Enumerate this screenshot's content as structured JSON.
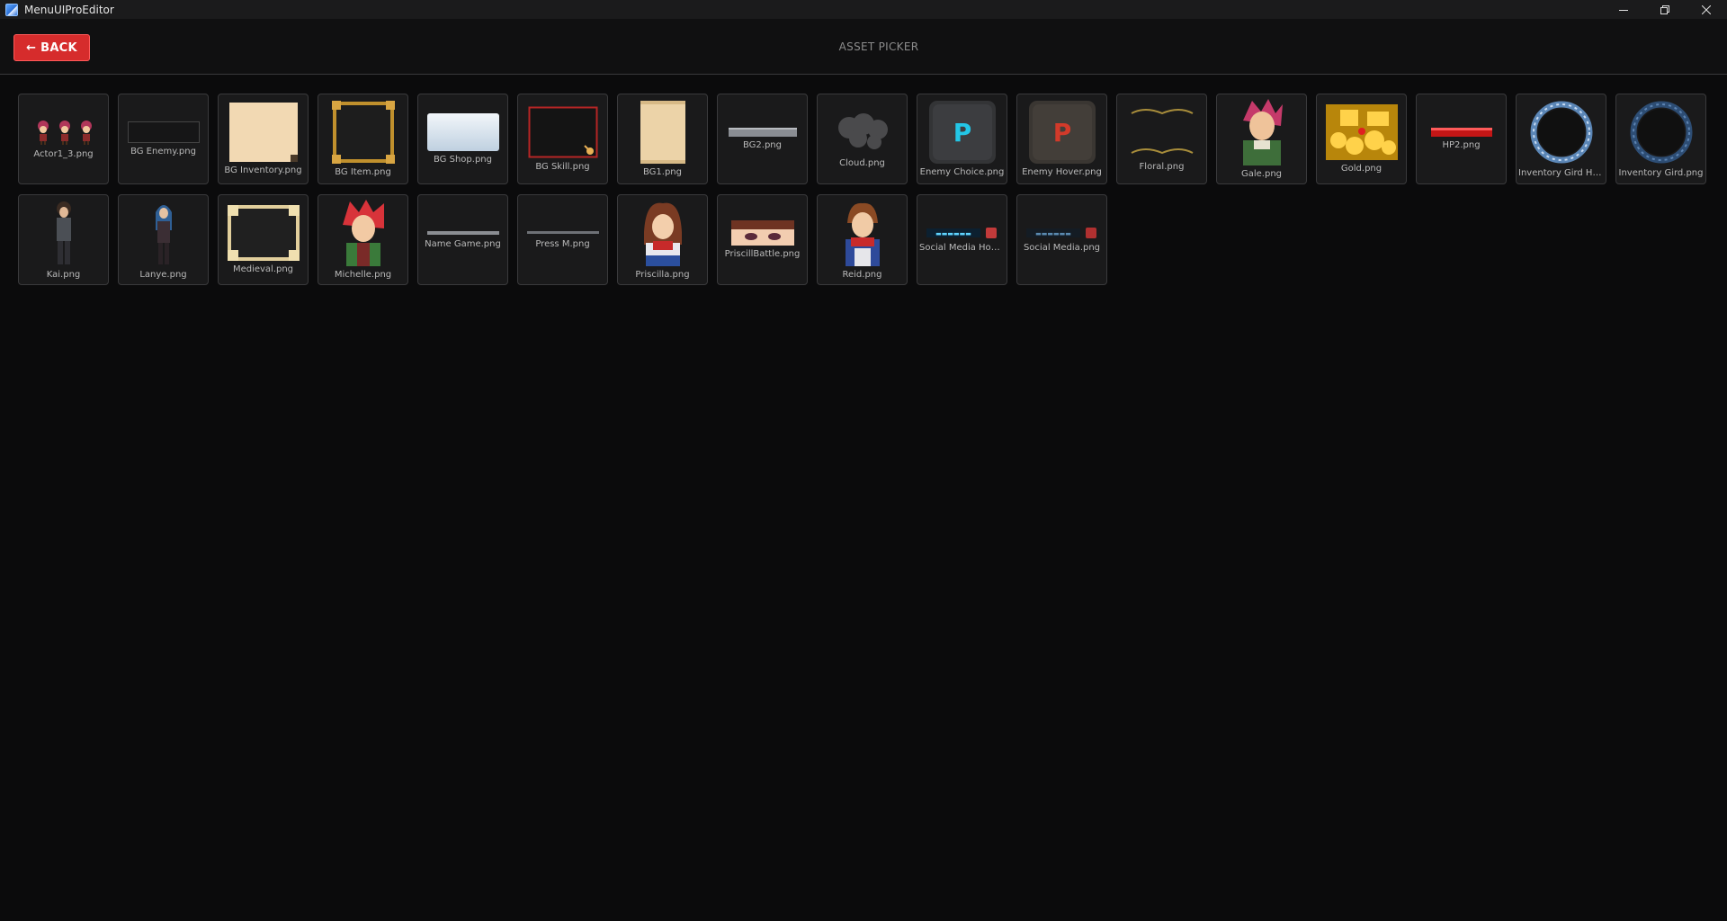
{
  "window": {
    "title": "MenuUIProEditor"
  },
  "header": {
    "back_label": "← BACK",
    "page_title": "ASSET PICKER"
  },
  "assets": [
    {
      "label": "Actor1_3.png",
      "icon": "chibi-sprites"
    },
    {
      "label": "BG Enemy.png",
      "icon": "dark-panel"
    },
    {
      "label": "BG Inventory.png",
      "icon": "parchment-panel"
    },
    {
      "label": "BG Item.png",
      "icon": "gold-frame"
    },
    {
      "label": "BG Shop.png",
      "icon": "light-panel"
    },
    {
      "label": "BG Skill.png",
      "icon": "red-frame"
    },
    {
      "label": "BG1.png",
      "icon": "parchment-scroll"
    },
    {
      "label": "BG2.png",
      "icon": "gray-bar"
    },
    {
      "label": "Cloud.png",
      "icon": "cloud"
    },
    {
      "label": "Enemy Choice.png",
      "icon": "stone-cyan-p"
    },
    {
      "label": "Enemy Hover.png",
      "icon": "stone-red-p"
    },
    {
      "label": "Floral.png",
      "icon": "floral-ornament"
    },
    {
      "label": "Gale.png",
      "icon": "character-portrait"
    },
    {
      "label": "Gold.png",
      "icon": "gold-treasure"
    },
    {
      "label": "HP2.png",
      "icon": "red-hp-bar"
    },
    {
      "label": "Inventory Gird Ho...",
      "icon": "blue-ring-glow"
    },
    {
      "label": "Inventory Gird.png",
      "icon": "blue-ring"
    },
    {
      "label": "Kai.png",
      "icon": "standing-character"
    },
    {
      "label": "Lanye.png",
      "icon": "standing-character-blue"
    },
    {
      "label": "Medieval.png",
      "icon": "ornate-frame"
    },
    {
      "label": "Michelle.png",
      "icon": "character-portrait-red"
    },
    {
      "label": "Name Game.png",
      "icon": "text-strip"
    },
    {
      "label": "Press M.png",
      "icon": "text-strip-small"
    },
    {
      "label": "Priscilla.png",
      "icon": "character-portrait-brown"
    },
    {
      "label": "PriscillBattle.png",
      "icon": "face-closeup"
    },
    {
      "label": "Reid.png",
      "icon": "character-portrait-boy"
    },
    {
      "label": "Social Media Hove...",
      "icon": "social-banner-glow"
    },
    {
      "label": "Social Media.png",
      "icon": "social-banner"
    }
  ]
}
